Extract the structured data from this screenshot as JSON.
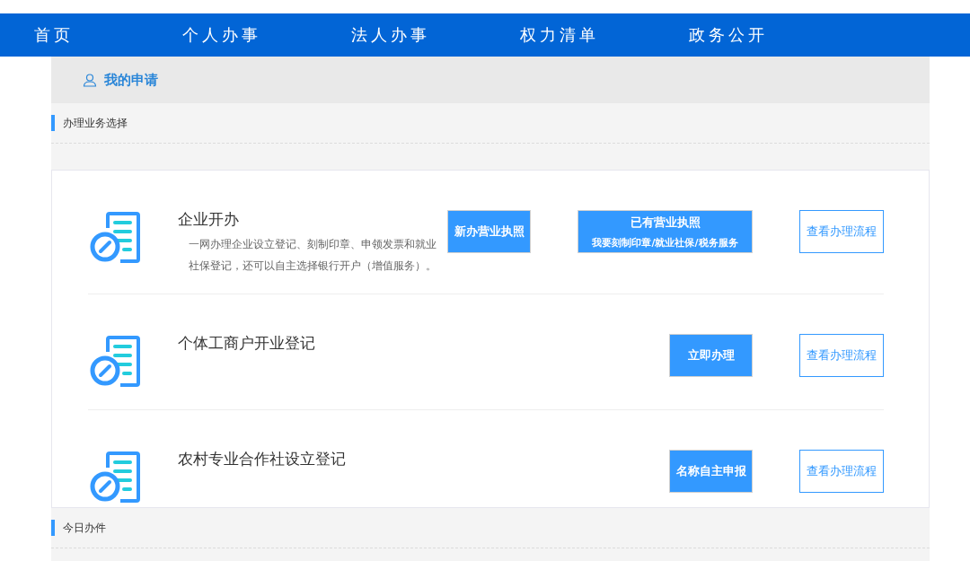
{
  "nav": [
    {
      "label": "首页"
    },
    {
      "label": "个人办事"
    },
    {
      "label": "法人办事"
    },
    {
      "label": "权力清单"
    },
    {
      "label": "政务公开"
    }
  ],
  "page_title": "我的申请",
  "section_business": "办理业务选择",
  "services": [
    {
      "title": "企业开办",
      "description": "一网办理企业设立登记、刻制印章、申领发票和就业社保登记，还可以自主选择银行开户（增值服务）。",
      "buttons": [
        {
          "kind": "primary",
          "label": "新办营业执照"
        },
        {
          "kind": "primary",
          "label": "已有营业执照",
          "sub_label": "我要刻制印章/就业社保/税务服务"
        },
        {
          "kind": "outline",
          "label": "查看办理流程"
        }
      ]
    },
    {
      "title": "个体工商户开业登记",
      "buttons": [
        {
          "kind": "primary",
          "label": "立即办理"
        },
        {
          "kind": "outline",
          "label": "查看办理流程"
        }
      ]
    },
    {
      "title": "农村专业合作社设立登记",
      "buttons": [
        {
          "kind": "primary",
          "label": "名称自主申报"
        },
        {
          "kind": "outline",
          "label": "查看办理流程"
        }
      ]
    }
  ],
  "section_today": "今日办件"
}
